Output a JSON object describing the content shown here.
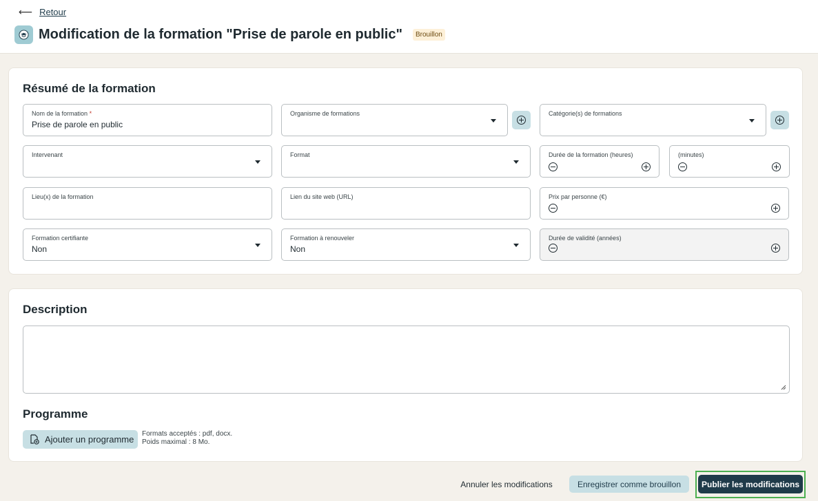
{
  "header": {
    "back_label": "Retour",
    "title": "Modification de la formation \"Prise de parole en public\"",
    "status_badge": "Brouillon"
  },
  "summary": {
    "title": "Résumé de la formation",
    "name": {
      "label": "Nom de la formation",
      "required_mark": "*",
      "value": "Prise de parole en public"
    },
    "organism": {
      "label": "Organisme de formations",
      "value": ""
    },
    "categories": {
      "label": "Catégorie(s) de formations",
      "value": ""
    },
    "speaker": {
      "label": "Intervenant",
      "value": ""
    },
    "format": {
      "label": "Format",
      "value": ""
    },
    "duration_hours": {
      "label": "Durée de la formation (heures)",
      "value": ""
    },
    "duration_minutes": {
      "label": "(minutes)",
      "value": ""
    },
    "location": {
      "label": "Lieu(x) de la formation",
      "value": ""
    },
    "website": {
      "label": "Lien du site web (URL)",
      "value": ""
    },
    "price": {
      "label": "Prix par personne (€)",
      "value": ""
    },
    "certifying": {
      "label": "Formation certifiante",
      "value": "Non"
    },
    "renewable": {
      "label": "Formation à renouveler",
      "value": "Non"
    },
    "validity": {
      "label": "Durée de validité (années)",
      "value": ""
    }
  },
  "description": {
    "title": "Description",
    "value": ""
  },
  "programme": {
    "title": "Programme",
    "add_label": "Ajouter un programme",
    "hint_formats": "Formats acceptés : pdf, docx.",
    "hint_size": "Poids maximal : 8 Mo."
  },
  "footer": {
    "cancel_label": "Annuler les modifications",
    "draft_label": "Enregistrer comme brouillon",
    "publish_label": "Publier les modifications"
  },
  "colors": {
    "primary": "#1f3b4a",
    "accent_light": "#c7dfe4",
    "badge_bg": "#fdf0d8",
    "focus_outline": "#4caf50"
  }
}
